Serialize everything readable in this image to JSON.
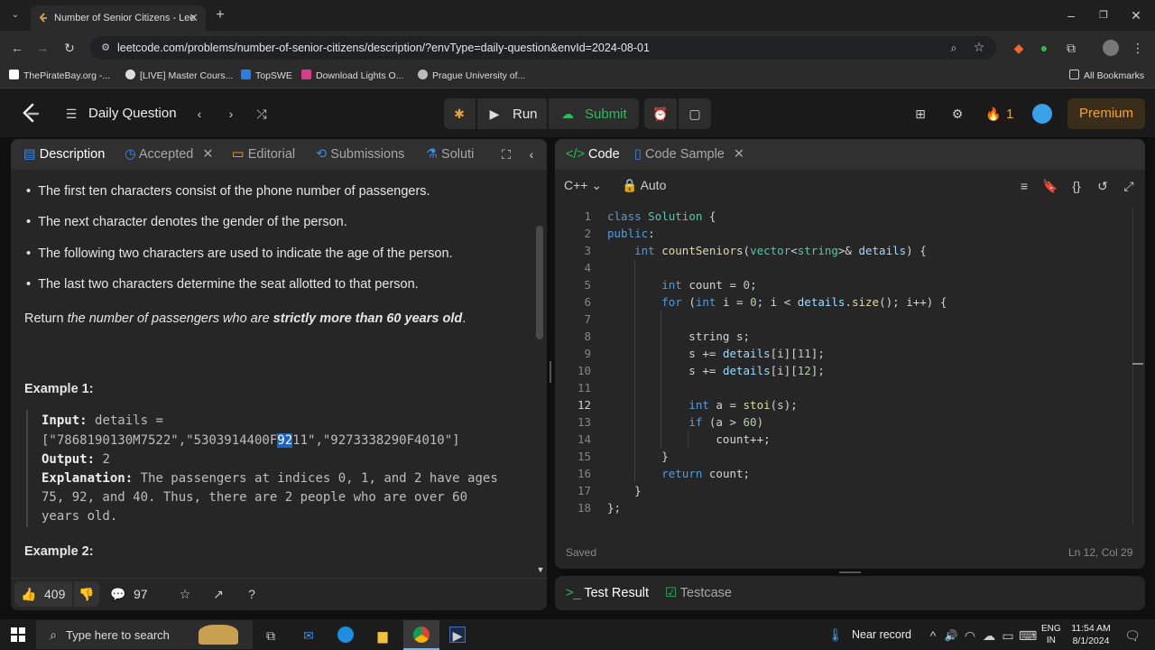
{
  "browser": {
    "tab_title": "Number of Senior Citizens - Lee",
    "url": "leetcode.com/problems/number-of-senior-citizens/description/?envType=daily-question&envId=2024-08-01",
    "bookmarks": [
      "ThePirateBay.org -...",
      "[LIVE] Master Cours...",
      "TopSWE",
      "Download Lights O...",
      "Prague University of..."
    ],
    "all_bookmarks": "All Bookmarks"
  },
  "nav": {
    "daily_question": "Daily Question",
    "run": "Run",
    "submit": "Submit",
    "streak": "1",
    "premium": "Premium"
  },
  "left_panel": {
    "tabs": [
      "Description",
      "Accepted",
      "Editorial",
      "Submissions",
      "Soluti"
    ],
    "bullets": [
      "The first ten characters consist of the phone number of passengers.",
      "The next character denotes the gender of the person.",
      "The following two characters are used to indicate the age of the person.",
      "The last two characters determine the seat allotted to that person."
    ],
    "return_prefix": "Return ",
    "return_italic": "the number of passengers who are ",
    "return_bold": "strictly more than 60 years old",
    "return_suffix": ".",
    "example1_title": "Example 1:",
    "input_label": "Input:",
    "input_value": "details =",
    "input_array_a": "[\"7868190130M7522\",\"5303914400F",
    "input_array_hl": "92",
    "input_array_b": "11\",\"9273338290F4010\"]",
    "output_label": "Output:",
    "output_value": "2",
    "explanation_label": "Explanation:",
    "explanation_line1": "The passengers at indices 0, 1, and 2 have ages",
    "explanation_line2": "75, 92, and 40. Thus, there are 2 people who are over 60",
    "explanation_line3": "years old.",
    "example2_title": "Example 2:",
    "likes": "409",
    "comments": "97"
  },
  "right_panel": {
    "tabs": [
      "Code",
      "Code Sample"
    ],
    "language": "C++",
    "mode": "Auto",
    "status": "Saved",
    "cursor": "Ln 12, Col 29",
    "line_numbers": [
      "1",
      "2",
      "3",
      "4",
      "5",
      "6",
      "7",
      "8",
      "9",
      "10",
      "11",
      "12",
      "13",
      "14",
      "15",
      "16",
      "17",
      "18"
    ]
  },
  "bottom_panel": {
    "test_result": "Test Result",
    "testcase": "Testcase"
  },
  "taskbar": {
    "search_placeholder": "Type here to search",
    "weather": "Near record",
    "lang_top": "ENG",
    "lang_bottom": "IN",
    "time": "11:54 AM",
    "date": "8/1/2024"
  },
  "colors": {
    "accent_orange": "#ffa116",
    "submit_green": "#2cbb5d",
    "highlight_blue": "#1e64c8"
  }
}
